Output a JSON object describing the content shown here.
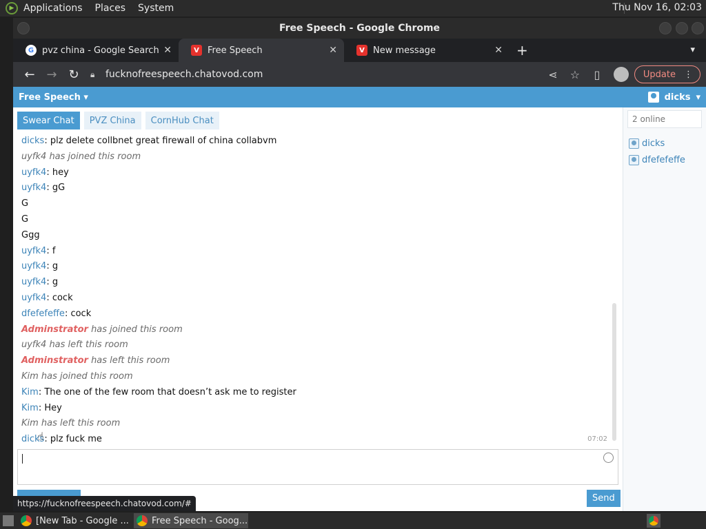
{
  "top_panel": {
    "menus": [
      "Applications",
      "Places",
      "System"
    ],
    "clock": "Thu Nov 16, 02:03"
  },
  "window": {
    "title": "Free Speech - Google Chrome"
  },
  "tabs": [
    {
      "title": "pvz china - Google Search",
      "favicon": "google-icon",
      "active": false
    },
    {
      "title": "Free Speech",
      "favicon": "chatovod-icon",
      "active": true
    },
    {
      "title": "New message",
      "favicon": "chatovod-icon",
      "active": false
    }
  ],
  "toolbar": {
    "url": "fucknofreespeech.chatovod.com",
    "update_label": "Update"
  },
  "site": {
    "room_title": "Free Speech",
    "username": "dicks",
    "accent_color": "#4a9bd1"
  },
  "room_tabs": [
    "Swear Chat",
    "PVZ China",
    "CornHub Chat"
  ],
  "messages": [
    {
      "type": "chat",
      "nick": "dicks",
      "text": "plz delete collbnet great firewall of china collabvm"
    },
    {
      "type": "system",
      "text": "uyfk4 has joined this room"
    },
    {
      "type": "chat",
      "nick": "uyfk4",
      "text": "hey"
    },
    {
      "type": "chat",
      "nick": "uyfk4",
      "text": "gG"
    },
    {
      "type": "plain",
      "text": "G"
    },
    {
      "type": "plain",
      "text": "G"
    },
    {
      "type": "plain",
      "text": "Ggg"
    },
    {
      "type": "chat",
      "nick": "uyfk4",
      "text": "f"
    },
    {
      "type": "chat",
      "nick": "uyfk4",
      "text": "g"
    },
    {
      "type": "chat",
      "nick": "uyfk4",
      "text": "g"
    },
    {
      "type": "chat",
      "nick": "uyfk4",
      "text": "cock"
    },
    {
      "type": "chat",
      "nick": "dfefefeffe",
      "text": "cock"
    },
    {
      "type": "admin",
      "nick": "Adminstrator",
      "text": "has joined this room"
    },
    {
      "type": "system",
      "text": "uyfk4 has left this room"
    },
    {
      "type": "admin",
      "nick": "Adminstrator",
      "text": "has left this room"
    },
    {
      "type": "system",
      "text": "Kim has joined this room"
    },
    {
      "type": "chat",
      "nick": "Kim",
      "text": "The one of the few room that doesn’t ask me to register"
    },
    {
      "type": "chat",
      "nick": "Kim",
      "text": "Hey"
    },
    {
      "type": "system",
      "text": "Kim has left this room"
    },
    {
      "type": "chat",
      "nick": "dicks",
      "text": "plz fuck me",
      "time": "07:02"
    }
  ],
  "composer": {
    "send_label": "Send"
  },
  "users_panel": {
    "online_count": "2 online",
    "users": [
      "dicks",
      "dfefefeffe"
    ]
  },
  "status_url": "https://fucknofreespeech.chatovod.com/#",
  "taskbar": {
    "tasks": [
      {
        "title": "[New Tab - Google ...",
        "active": false
      },
      {
        "title": "Free Speech - Goog...",
        "active": true
      }
    ]
  }
}
